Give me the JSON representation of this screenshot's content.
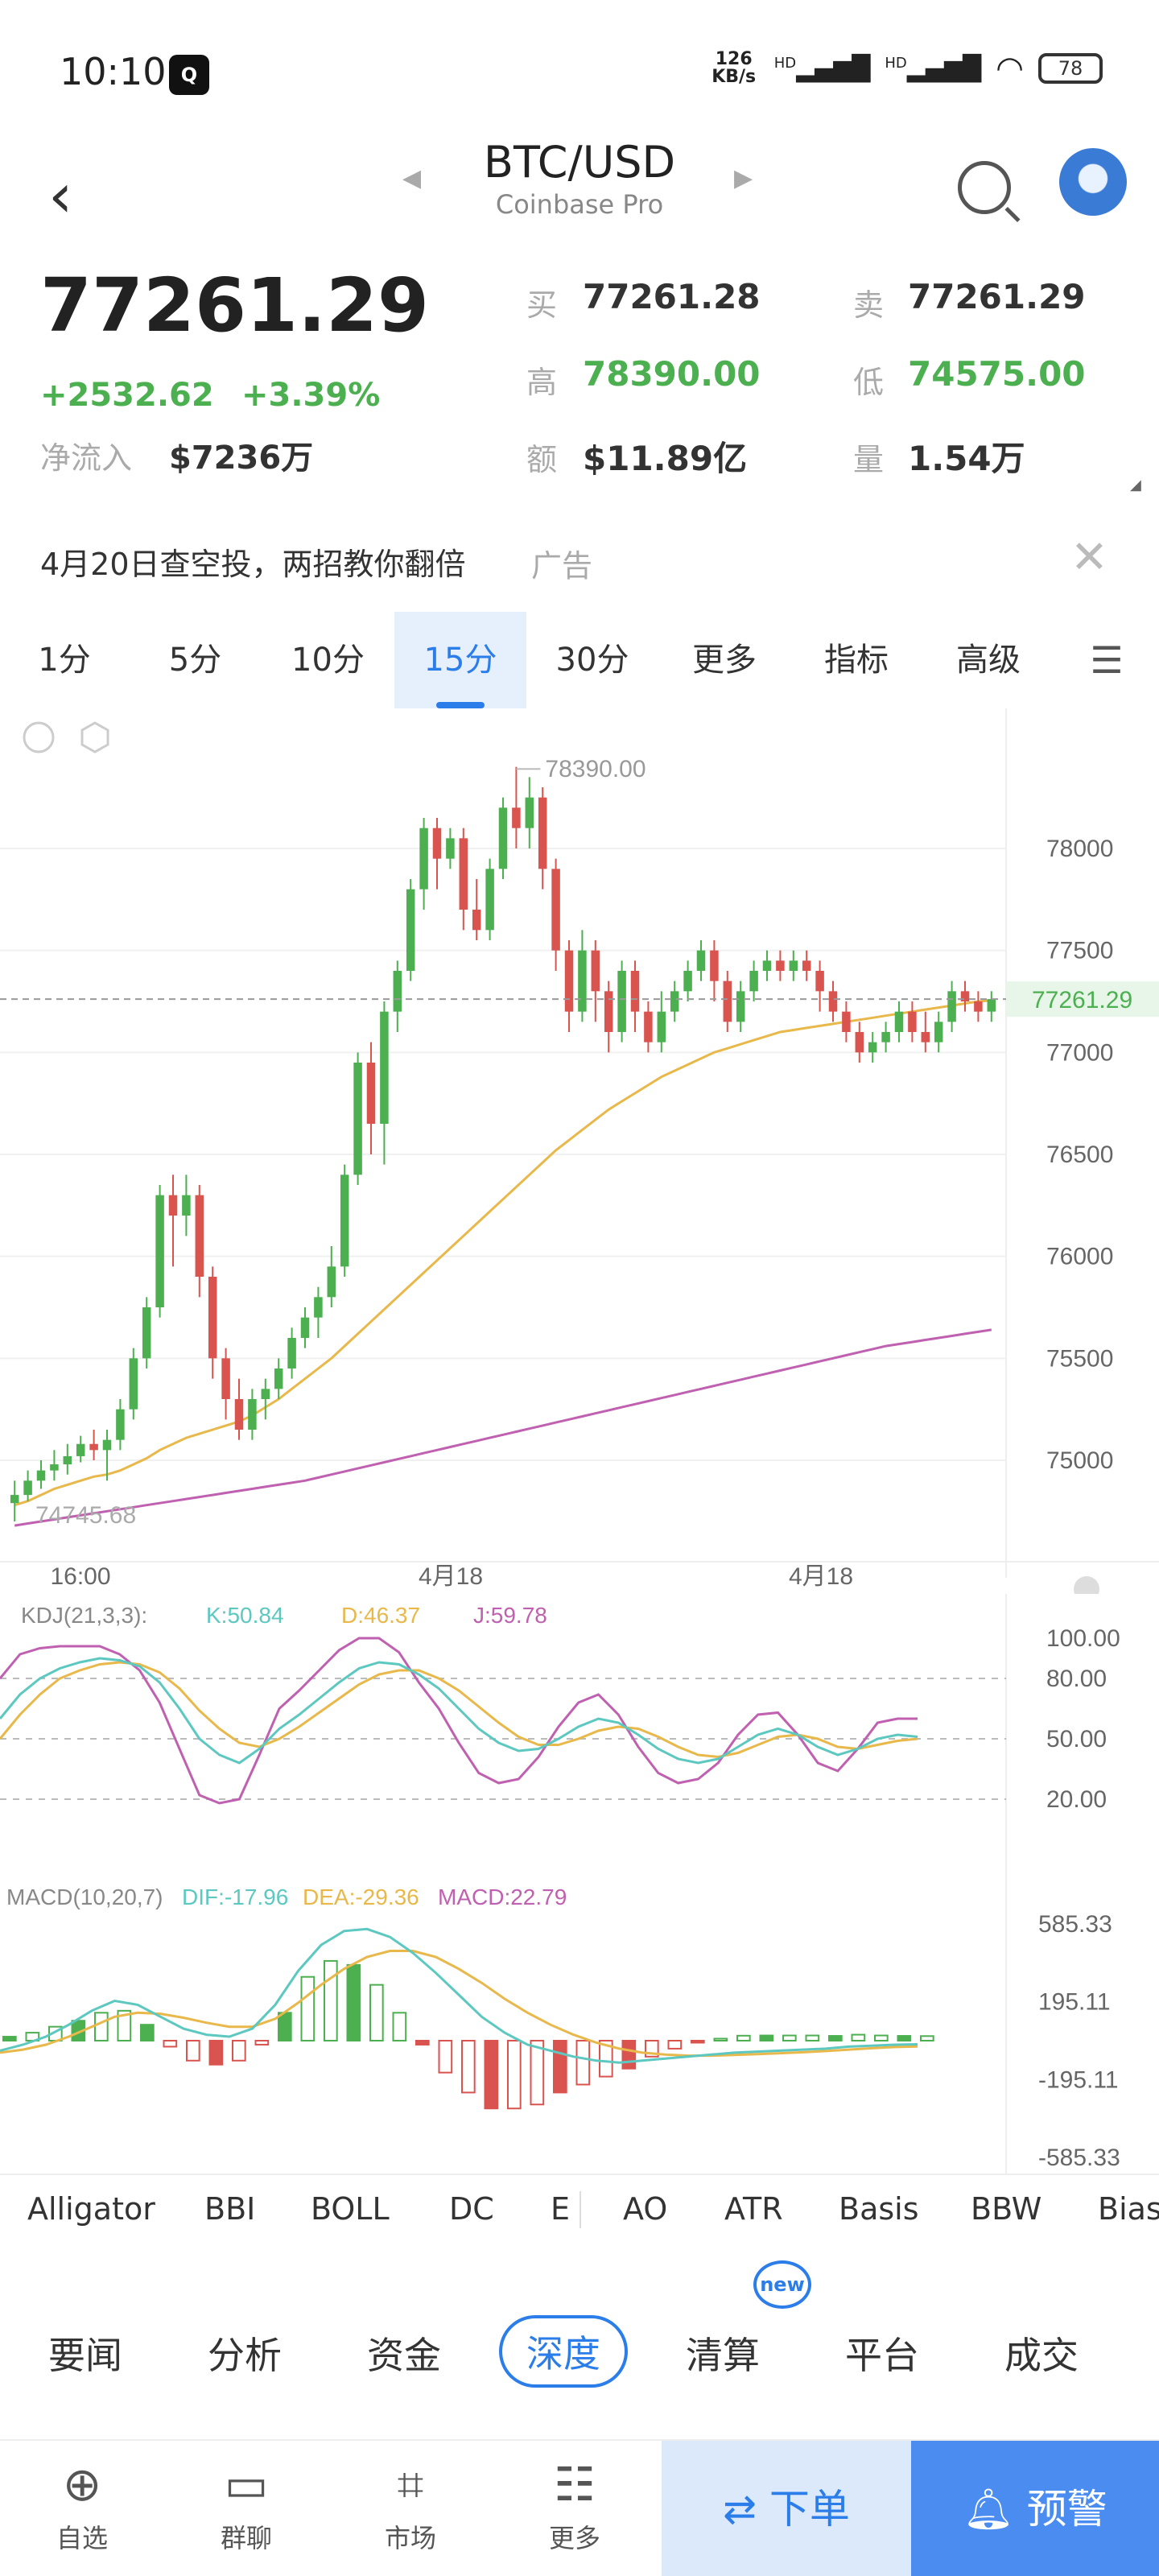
{
  "status_bar": {
    "time": "10:10",
    "app_icon": "app-icon",
    "net_speed": "126 KB/s",
    "hd1": "HD",
    "hd2": "HD",
    "battery": "78"
  },
  "header": {
    "pair": "BTC/USD",
    "exchange": "Coinbase Pro"
  },
  "ticker": {
    "price": "77261.29",
    "change": "+2532.62",
    "change_pct": "+3.39%",
    "inflow_label": "净流入",
    "inflow_value": "$7236万",
    "buy_label": "买",
    "buy_value": "77261.28",
    "sell_label": "卖",
    "sell_value": "77261.29",
    "high_label": "高",
    "high_value": "78390.00",
    "low_label": "低",
    "low_value": "74575.00",
    "amount_label": "额",
    "amount_value": "$11.89亿",
    "volume_label": "量",
    "volume_value": "1.54万"
  },
  "ad": {
    "text": "4月20日查空投，两招教你翻倍",
    "tag": "广告"
  },
  "intervals": [
    "1分",
    "5分",
    "10分",
    "15分",
    "30分",
    "更多",
    "指标",
    "高级"
  ],
  "active_interval": "15分",
  "main_chart": {
    "high_label": "78390.00",
    "low_label": "74745.68",
    "current_price_label": "77261.29",
    "y_ticks": [
      "78000",
      "77500",
      "77000",
      "76500",
      "76000",
      "75500",
      "75000"
    ],
    "x_ticks": [
      "16:00",
      "4月18",
      "4月18"
    ]
  },
  "kdj": {
    "title": "KDJ(21,3,3):",
    "k": "K:50.84",
    "d": "D:46.37",
    "j": "J:59.78",
    "y_ticks": [
      "100.00",
      "80.00",
      "50.00",
      "20.00"
    ]
  },
  "macd": {
    "title": "MACD(10,20,7)",
    "dif": "DIF:-17.96",
    "dea": "DEA:-29.36",
    "macd": "MACD:22.79",
    "y_ticks": [
      "585.33",
      "195.11",
      "-195.11",
      "-585.33"
    ]
  },
  "indicator_tabs": [
    "Alligator",
    "BBI",
    "BOLL",
    "DC",
    "E",
    "AO",
    "ATR",
    "Basis",
    "BBW",
    "Bias"
  ],
  "new_badge": "new",
  "news_tabs": [
    "要闻",
    "分析",
    "资金",
    "深度",
    "清算",
    "平台",
    "成交"
  ],
  "active_news_tab": "深度",
  "bottom_nav": {
    "watch": "自选",
    "chat": "群聊",
    "market": "市场",
    "more": "更多",
    "order": "下单",
    "alert": "预警"
  },
  "colors": {
    "up": "#4caf50",
    "down": "#d9534f",
    "accent": "#2b7de9",
    "ma_short": "#e8b84a",
    "ma_long": "#c060b0",
    "k_line": "#5cc8c0"
  },
  "chart_data": {
    "type": "candlestick",
    "ylim": [
      74700,
      78450
    ],
    "candles": [
      [
        74790,
        74830,
        74700,
        74900
      ],
      [
        74830,
        74900,
        74800,
        74950
      ],
      [
        74900,
        74950,
        74860,
        75000
      ],
      [
        74950,
        74980,
        74900,
        75050
      ],
      [
        74980,
        75020,
        74930,
        75080
      ],
      [
        75020,
        75080,
        74990,
        75120
      ],
      [
        75080,
        75050,
        75000,
        75150
      ],
      [
        75050,
        75100,
        74900,
        75150
      ],
      [
        75100,
        75250,
        75050,
        75300
      ],
      [
        75250,
        75500,
        75200,
        75550
      ],
      [
        75500,
        75750,
        75450,
        75800
      ],
      [
        75750,
        76300,
        75700,
        76350
      ],
      [
        76300,
        76200,
        75950,
        76400
      ],
      [
        76200,
        76300,
        76100,
        76400
      ],
      [
        76300,
        75900,
        75800,
        76350
      ],
      [
        75900,
        75500,
        75400,
        75950
      ],
      [
        75500,
        75300,
        75200,
        75550
      ],
      [
        75300,
        75150,
        75100,
        75400
      ],
      [
        75150,
        75300,
        75100,
        75350
      ],
      [
        75300,
        75350,
        75200,
        75400
      ],
      [
        75350,
        75450,
        75300,
        75500
      ],
      [
        75450,
        75600,
        75400,
        75650
      ],
      [
        75600,
        75700,
        75550,
        75750
      ],
      [
        75700,
        75800,
        75600,
        75850
      ],
      [
        75800,
        75950,
        75750,
        76050
      ],
      [
        75950,
        76400,
        75900,
        76450
      ],
      [
        76400,
        76950,
        76350,
        77000
      ],
      [
        76950,
        76650,
        76500,
        77050
      ],
      [
        76650,
        77200,
        76450,
        77250
      ],
      [
        77200,
        77400,
        77100,
        77450
      ],
      [
        77400,
        77800,
        77350,
        77850
      ],
      [
        77800,
        78100,
        77700,
        78150
      ],
      [
        78100,
        77950,
        77800,
        78150
      ],
      [
        77950,
        78050,
        77900,
        78100
      ],
      [
        78050,
        77700,
        77600,
        78100
      ],
      [
        77700,
        77600,
        77550,
        77850
      ],
      [
        77600,
        77900,
        77550,
        77950
      ],
      [
        77900,
        78200,
        77850,
        78250
      ],
      [
        78200,
        78100,
        78000,
        78400
      ],
      [
        78100,
        78250,
        78000,
        78350
      ],
      [
        78250,
        77900,
        77800,
        78300
      ],
      [
        77900,
        77500,
        77400,
        77950
      ],
      [
        77500,
        77200,
        77100,
        77550
      ],
      [
        77200,
        77500,
        77150,
        77600
      ],
      [
        77500,
        77300,
        77150,
        77550
      ],
      [
        77300,
        77100,
        77000,
        77350
      ],
      [
        77100,
        77400,
        77050,
        77450
      ],
      [
        77400,
        77200,
        77100,
        77450
      ],
      [
        77200,
        77050,
        77000,
        77250
      ],
      [
        77050,
        77200,
        77000,
        77300
      ],
      [
        77200,
        77300,
        77150,
        77350
      ],
      [
        77300,
        77400,
        77250,
        77450
      ],
      [
        77400,
        77500,
        77350,
        77550
      ],
      [
        77500,
        77350,
        77250,
        77550
      ],
      [
        77350,
        77150,
        77100,
        77400
      ],
      [
        77150,
        77300,
        77100,
        77350
      ],
      [
        77300,
        77400,
        77250,
        77450
      ],
      [
        77400,
        77450,
        77350,
        77500
      ],
      [
        77450,
        77400,
        77350,
        77500
      ],
      [
        77400,
        77450,
        77350,
        77500
      ],
      [
        77450,
        77400,
        77350,
        77500
      ],
      [
        77400,
        77300,
        77200,
        77450
      ],
      [
        77300,
        77200,
        77150,
        77350
      ],
      [
        77200,
        77100,
        77050,
        77250
      ],
      [
        77100,
        77000,
        76950,
        77150
      ],
      [
        77000,
        77050,
        76950,
        77100
      ],
      [
        77050,
        77100,
        77000,
        77150
      ],
      [
        77100,
        77200,
        77050,
        77250
      ],
      [
        77200,
        77100,
        77050,
        77250
      ],
      [
        77100,
        77050,
        77000,
        77200
      ],
      [
        77050,
        77150,
        77000,
        77200
      ],
      [
        77150,
        77300,
        77100,
        77350
      ],
      [
        77300,
        77250,
        77200,
        77350
      ],
      [
        77250,
        77200,
        77150,
        77300
      ],
      [
        77200,
        77261.29,
        77150,
        77300
      ]
    ],
    "ma_short": [
      74780,
      74800,
      74830,
      74860,
      74880,
      74900,
      74920,
      74930,
      74950,
      74980,
      75010,
      75050,
      75080,
      75110,
      75130,
      75150,
      75170,
      75190,
      75220,
      75260,
      75300,
      75350,
      75400,
      75450,
      75500,
      75560,
      75620,
      75680,
      75740,
      75800,
      75860,
      75920,
      75980,
      76040,
      76100,
      76160,
      76220,
      76280,
      76340,
      76400,
      76460,
      76520,
      76570,
      76620,
      76670,
      76720,
      76760,
      76800,
      76840,
      76880,
      76910,
      76940,
      76970,
      77000,
      77020,
      77040,
      77060,
      77080,
      77100,
      77110,
      77120,
      77130,
      77140,
      77150,
      77160,
      77170,
      77180,
      77190,
      77200,
      77210,
      77220,
      77230,
      77240,
      77250,
      77255
    ],
    "ma_long": [
      74680,
      74690,
      74700,
      74710,
      74720,
      74730,
      74740,
      74750,
      74760,
      74770,
      74780,
      74790,
      74800,
      74810,
      74820,
      74830,
      74840,
      74850,
      74860,
      74870,
      74880,
      74890,
      74900,
      74915,
      74930,
      74945,
      74960,
      74975,
      74990,
      75005,
      75020,
      75035,
      75050,
      75065,
      75080,
      75095,
      75110,
      75125,
      75140,
      75155,
      75170,
      75185,
      75200,
      75215,
      75230,
      75245,
      75260,
      75275,
      75290,
      75305,
      75320,
      75335,
      75350,
      75365,
      75380,
      75395,
      75410,
      75425,
      75440,
      75455,
      75470,
      75485,
      75500,
      75515,
      75530,
      75545,
      75560,
      75570,
      75580,
      75590,
      75600,
      75610,
      75620,
      75630,
      75640
    ],
    "kdj_k": [
      60,
      72,
      80,
      85,
      88,
      90,
      89,
      86,
      78,
      65,
      50,
      42,
      38,
      45,
      55,
      62,
      70,
      78,
      85,
      88,
      87,
      82,
      75,
      65,
      55,
      48,
      44,
      45,
      50,
      56,
      60,
      58,
      52,
      45,
      40,
      38,
      40,
      46,
      52,
      55,
      52,
      46,
      42,
      45,
      50,
      52,
      51
    ],
    "kdj_d": [
      50,
      62,
      72,
      80,
      84,
      87,
      88,
      87,
      83,
      75,
      64,
      55,
      48,
      46,
      50,
      56,
      63,
      70,
      77,
      82,
      84,
      84,
      80,
      74,
      66,
      58,
      51,
      47,
      47,
      50,
      54,
      56,
      55,
      51,
      46,
      42,
      41,
      43,
      47,
      51,
      52,
      50,
      46,
      45,
      47,
      49,
      50
    ],
    "kdj_j": [
      80,
      92,
      95,
      96,
      96,
      96,
      92,
      84,
      68,
      45,
      22,
      18,
      20,
      42,
      65,
      74,
      84,
      94,
      100,
      100,
      93,
      78,
      65,
      48,
      33,
      28,
      30,
      41,
      56,
      68,
      72,
      62,
      46,
      33,
      28,
      30,
      38,
      52,
      62,
      63,
      52,
      38,
      34,
      45,
      58,
      60,
      60
    ],
    "macd_dif": [
      -50,
      -20,
      20,
      80,
      150,
      200,
      180,
      120,
      60,
      30,
      20,
      60,
      180,
      350,
      480,
      550,
      560,
      520,
      440,
      340,
      230,
      120,
      40,
      -20,
      -50,
      -80,
      -100,
      -110,
      -100,
      -90,
      -80,
      -70,
      -60,
      -55,
      -50,
      -45,
      -40,
      -30,
      -25,
      -20,
      -18
    ],
    "macd_dea": [
      -60,
      -45,
      -20,
      20,
      70,
      120,
      140,
      135,
      115,
      90,
      70,
      70,
      110,
      190,
      280,
      360,
      420,
      450,
      450,
      420,
      360,
      290,
      210,
      140,
      80,
      30,
      -10,
      -40,
      -60,
      -70,
      -75,
      -75,
      -72,
      -68,
      -63,
      -58,
      -52,
      -45,
      -38,
      -32,
      -29
    ],
    "macd_hist": [
      20,
      40,
      70,
      100,
      140,
      150,
      80,
      -30,
      -100,
      -120,
      -100,
      -20,
      140,
      320,
      400,
      380,
      280,
      140,
      -20,
      -160,
      -260,
      -340,
      -340,
      -320,
      -260,
      -220,
      -180,
      -140,
      -80,
      -40,
      -10,
      10,
      25,
      26,
      26,
      26,
      24,
      30,
      26,
      24,
      23
    ]
  }
}
